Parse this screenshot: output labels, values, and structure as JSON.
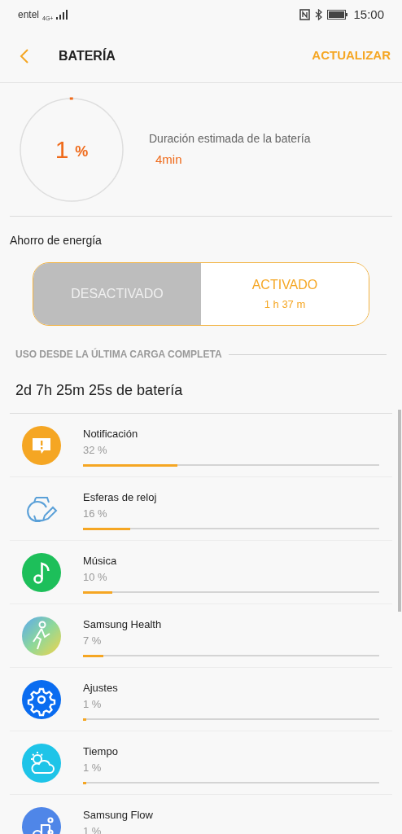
{
  "status_bar": {
    "carrier": "entel",
    "network": "4G+",
    "time": "15:00"
  },
  "header": {
    "title": "BATERÍA",
    "action": "ACTUALIZAR"
  },
  "battery": {
    "percent": "1",
    "unit": "%",
    "level": 0.01,
    "estimate_label": "Duración estimada de la batería",
    "estimate_value": "4min"
  },
  "power_saving": {
    "label": "Ahorro de energía",
    "options": [
      {
        "label": "DESACTIVADO",
        "selected": false
      },
      {
        "label": "ACTIVADO",
        "sublabel": "1 h 37 m",
        "selected": true
      }
    ]
  },
  "usage": {
    "section_title": "USO DESDE LA ÚLTIMA CARGA COMPLETA",
    "total": "2d 7h 25m 25s de batería",
    "apps": [
      {
        "name": "Notificación",
        "percent": "32 %",
        "level": 0.32,
        "kind": "notification"
      },
      {
        "name": "Esferas de reloj",
        "percent": "16 %",
        "level": 0.16,
        "kind": "watchface"
      },
      {
        "name": "Música",
        "percent": "10 %",
        "level": 0.1,
        "kind": "music"
      },
      {
        "name": "Samsung Health",
        "percent": "7 %",
        "level": 0.07,
        "kind": "health"
      },
      {
        "name": "Ajustes",
        "percent": "1 %",
        "level": 0.01,
        "kind": "settings"
      },
      {
        "name": "Tiempo",
        "percent": "1 %",
        "level": 0.01,
        "kind": "weather"
      },
      {
        "name": "Samsung Flow",
        "percent": "1 %",
        "kind": "flow"
      }
    ]
  }
}
